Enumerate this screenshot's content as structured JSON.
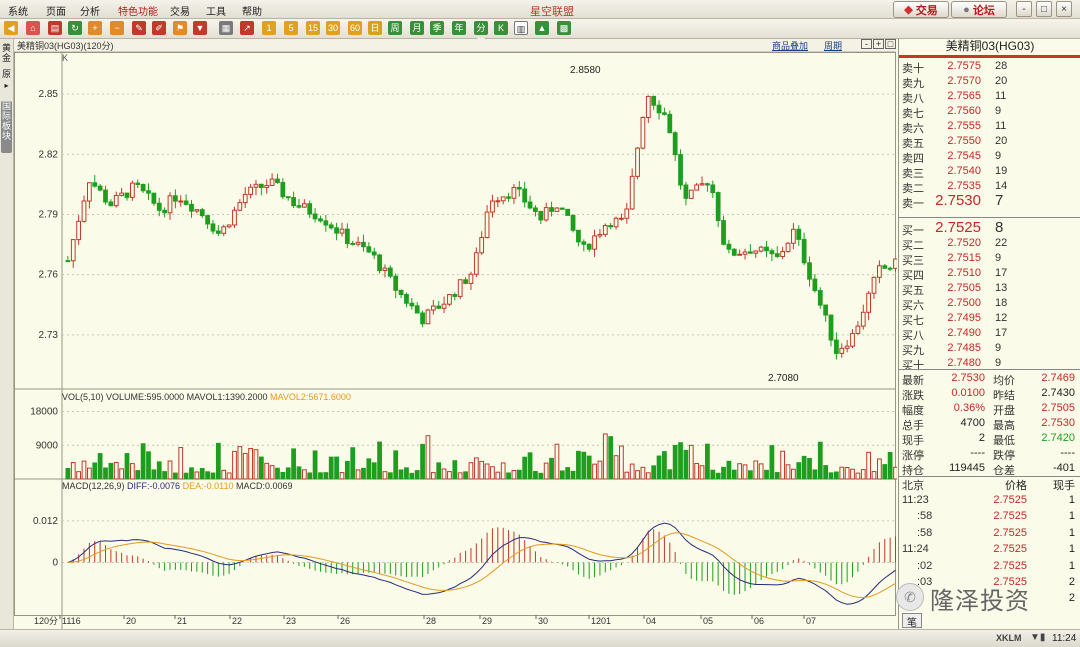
{
  "menu": [
    "系统",
    "页面",
    "分析",
    "特色功能",
    "交易",
    "工具",
    "帮助"
  ],
  "app_title": "星空联盟",
  "top_buttons": {
    "trade": "交易",
    "forum": "论坛"
  },
  "window_controls": [
    "-",
    "□",
    "×"
  ],
  "toolbar_labels": [
    "1",
    "5",
    "15",
    "30",
    "60",
    "日",
    "周",
    "月",
    "季",
    "年",
    "分笔",
    "K"
  ],
  "side_tabs": {
    "gold": "黄金",
    "origin": "原",
    "intl": "国际板块"
  },
  "chart": {
    "header_title": "美精铜03(HG03)(120分)",
    "overlay_link": "商品叠加",
    "period_link": "周期",
    "k_label": "K",
    "high_label": "2.8580",
    "low_label": "2.7080",
    "vol_legend": {
      "vol": "VOL(5,10)",
      "volume": "VOLUME:595.0000",
      "m1": "MAVOL1:1390.2000",
      "m2": "MAVOL2:5671.6000"
    },
    "macd_legend": {
      "macd": "MACD(12,26,9)",
      "diff": "DIFF:-0.0076",
      "dea": "DEA:-0.0110",
      "bar": "MACD:0.0069"
    },
    "period_label": "120分",
    "colors": {
      "up": "#c0392b",
      "down": "#1e9e1e",
      "diff": "#2b2b7a",
      "dea": "#e39a1e",
      "ma1": "#333333",
      "ma2": "#e39a1e"
    }
  },
  "chart_data": {
    "type": "candlestick",
    "price_axis": {
      "ticks": [
        "2.85",
        "2.82",
        "2.79",
        "2.76",
        "2.73"
      ],
      "range": [
        2.704,
        2.868
      ]
    },
    "volume_axis": {
      "ticks": [
        "18000",
        "9000"
      ],
      "range": [
        0,
        20000
      ]
    },
    "macd_axis": {
      "ticks": [
        "0.012",
        "0"
      ],
      "range": [
        -0.018,
        0.018
      ]
    },
    "x_labels": [
      "1116",
      "20",
      "21",
      "22",
      "23",
      "26",
      "28",
      "29",
      "30",
      "1201",
      "04",
      "05",
      "06",
      "07"
    ],
    "last_price": 2.7525,
    "high": 2.858,
    "low": 2.708,
    "num_bars": 155
  },
  "quote": {
    "title": "美精铜03(HG03)",
    "asks": [
      {
        "label": "卖十",
        "price": "2.7575",
        "vol": "28"
      },
      {
        "label": "卖九",
        "price": "2.7570",
        "vol": "20"
      },
      {
        "label": "卖八",
        "price": "2.7565",
        "vol": "11"
      },
      {
        "label": "卖七",
        "price": "2.7560",
        "vol": "9"
      },
      {
        "label": "卖六",
        "price": "2.7555",
        "vol": "11"
      },
      {
        "label": "卖五",
        "price": "2.7550",
        "vol": "20"
      },
      {
        "label": "卖四",
        "price": "2.7545",
        "vol": "9"
      },
      {
        "label": "卖三",
        "price": "2.7540",
        "vol": "19"
      },
      {
        "label": "卖二",
        "price": "2.7535",
        "vol": "14"
      },
      {
        "label": "卖一",
        "price": "2.7530",
        "vol": "7"
      }
    ],
    "bids": [
      {
        "label": "买一",
        "price": "2.7525",
        "vol": "8"
      },
      {
        "label": "买二",
        "price": "2.7520",
        "vol": "22"
      },
      {
        "label": "买三",
        "price": "2.7515",
        "vol": "9"
      },
      {
        "label": "买四",
        "price": "2.7510",
        "vol": "17"
      },
      {
        "label": "买五",
        "price": "2.7505",
        "vol": "13"
      },
      {
        "label": "买六",
        "price": "2.7500",
        "vol": "18"
      },
      {
        "label": "买七",
        "price": "2.7495",
        "vol": "12"
      },
      {
        "label": "买八",
        "price": "2.7490",
        "vol": "17"
      },
      {
        "label": "买九",
        "price": "2.7485",
        "vol": "9"
      },
      {
        "label": "买十",
        "price": "2.7480",
        "vol": "9"
      }
    ],
    "stats": [
      {
        "l1": "最新",
        "v1": "2.7530",
        "c1": "#c62828",
        "l2": "均价",
        "v2": "2.7469",
        "c2": "#c62828"
      },
      {
        "l1": "涨跌",
        "v1": "0.0100",
        "c1": "#c62828",
        "l2": "昨结",
        "v2": "2.7430",
        "c2": "#222"
      },
      {
        "l1": "幅度",
        "v1": "0.36%",
        "c1": "#c62828",
        "l2": "开盘",
        "v2": "2.7505",
        "c2": "#c62828"
      },
      {
        "l1": "总手",
        "v1": "4700",
        "c1": "#222",
        "l2": "最高",
        "v2": "2.7530",
        "c2": "#c62828"
      },
      {
        "l1": "现手",
        "v1": "2",
        "c1": "#222",
        "l2": "最低",
        "v2": "2.7420",
        "c2": "#1e9e1e"
      },
      {
        "l1": "涨停",
        "v1": "----",
        "c1": "#222",
        "l2": "跌停",
        "v2": "----",
        "c2": "#222"
      },
      {
        "l1": "持仓",
        "v1": "119445",
        "c1": "#222",
        "l2": "仓差",
        "v2": "-401",
        "c2": "#222"
      }
    ],
    "ticks_header": {
      "loc": "北京",
      "price": "价格",
      "vol": "现手"
    },
    "ticks": [
      {
        "time": "11:23",
        "price": "2.7525",
        "vol": "1"
      },
      {
        "time": ":58",
        "price": "2.7525",
        "vol": "1"
      },
      {
        "time": ":58",
        "price": "2.7525",
        "vol": "1"
      },
      {
        "time": "11:24",
        "price": "2.7525",
        "vol": "1"
      },
      {
        "time": ":02",
        "price": "2.7525",
        "vol": "1"
      },
      {
        "time": ":03",
        "price": "2.7525",
        "vol": "2"
      },
      {
        "time": "",
        "price": "",
        "vol": "2"
      }
    ],
    "bottom_tab": "笔"
  },
  "watermark": "隆泽投资",
  "status": {
    "time": "11:24",
    "brand": "XKLM"
  }
}
